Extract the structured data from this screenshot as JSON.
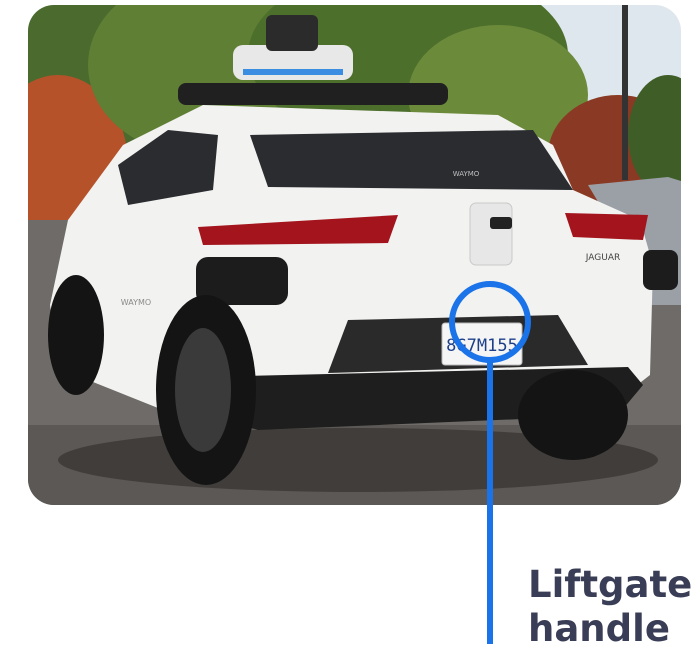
{
  "photo": {
    "subject_icon": "car-icon",
    "badge_text": "JAGUAR",
    "brand_text": "WAYMO",
    "plate_text": "8G7M155"
  },
  "callout": {
    "line1": "Liftgate",
    "line2": "handle",
    "accent_color": "#1a73e8",
    "text_color": "#3a3d56"
  }
}
